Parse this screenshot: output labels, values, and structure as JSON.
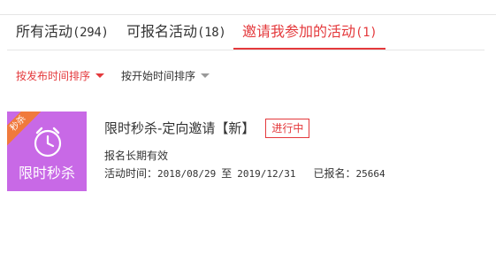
{
  "tabs": [
    {
      "label": "所有活动",
      "count": "(294)",
      "active": false
    },
    {
      "label": "可报名活动",
      "count": "(18)",
      "active": false
    },
    {
      "label": "邀请我参加的活动",
      "count": "(1)",
      "active": true
    }
  ],
  "sort": {
    "by_publish": "按发布时间排序",
    "by_start": "按开始时间排序"
  },
  "activity": {
    "thumb_ribbon": "秒杀",
    "thumb_title": "限时秒杀",
    "title": "限时秒杀-定向邀请【新】",
    "status": "进行中",
    "validity": "报名长期有效",
    "time_label": "活动时间：",
    "start_date": "2018/08/29",
    "to": "至",
    "end_date": "2019/12/31",
    "signed_label": "已报名：",
    "signed_count": "25664"
  },
  "colors": {
    "accent": "#e4393c",
    "thumb_bg": "#c869e6",
    "ribbon": "#f07a3c"
  },
  "icons": {
    "thumb_icon": "alarm-clock-icon",
    "sort_caret": "caret-down-icon"
  }
}
